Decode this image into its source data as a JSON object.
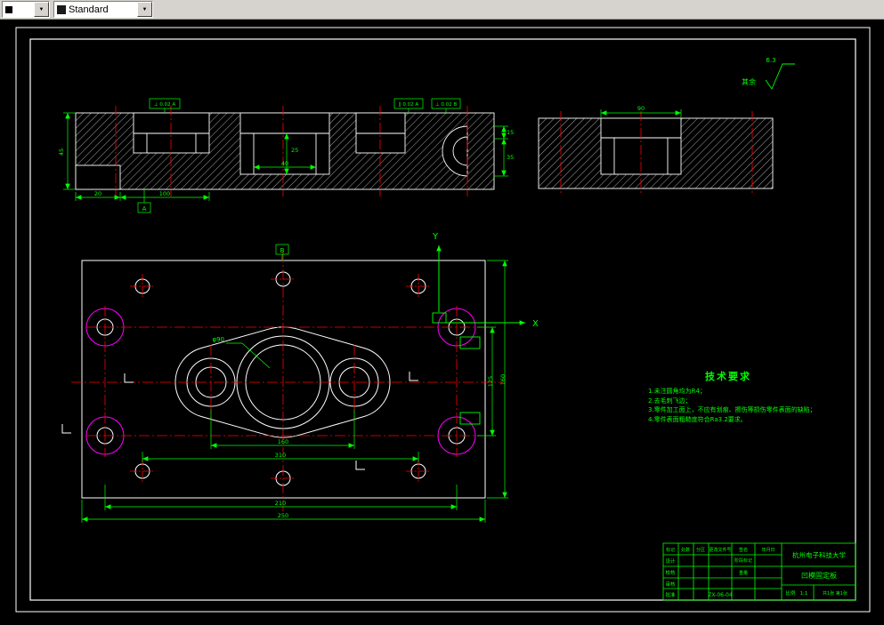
{
  "toolbar": {
    "style_value": "Standard"
  },
  "surface_finish": {
    "prefix": "其余",
    "value": "6.3"
  },
  "axes": {
    "x": "X",
    "y": "Y"
  },
  "datums": {
    "a": "A",
    "b": "B"
  },
  "fcf": {
    "f1": "⊥ 0.02 A",
    "f2": "∥ 0.02 A",
    "f3": "⊥ 0.02 B"
  },
  "dims": {
    "front_height": "45",
    "front_step": "20",
    "front_bottom": "100",
    "front_pocket_depth": "25",
    "front_pocket_width": "40",
    "front_right_upper": "15",
    "front_right_lower": "35",
    "side_pocket": "90",
    "plan_bottom_inner": "210",
    "plan_bottom_overall": "250",
    "plan_right_inner": "125",
    "plan_right_overall": "160",
    "plan_span_big": "160",
    "plan_span_bolt": "310",
    "plan_leader": "φ90"
  },
  "tech_req": {
    "title": "技术要求",
    "items": [
      "1.未注圆角均为R4；",
      "2.去毛刺飞边；",
      "3.零件加工面上，不应有划痕、擦伤等损伤零件表面的缺陷；",
      "4.零件表面粗糙度符合Ra3.2要求。"
    ]
  },
  "title_block": {
    "university": "杭州电子科技大学",
    "part_name": "凹模固定板",
    "drawing_no": "ZX-06-04",
    "header_cells": [
      "标记",
      "处数",
      "分区",
      "更改文件号",
      "签名",
      "年月日"
    ],
    "row_labels": [
      "设计",
      "校核",
      "审核",
      "批准"
    ],
    "stage_label": "阶段标记",
    "weight_label": "重量",
    "scale_label": "比例",
    "scale_value": "1:1",
    "sheet_info": "共1张 第1张"
  },
  "colors": {
    "dimension": "#00ff00",
    "centerline": "#ff0000",
    "outline": "#ffffff",
    "guide_hole": "#ff00ff"
  }
}
